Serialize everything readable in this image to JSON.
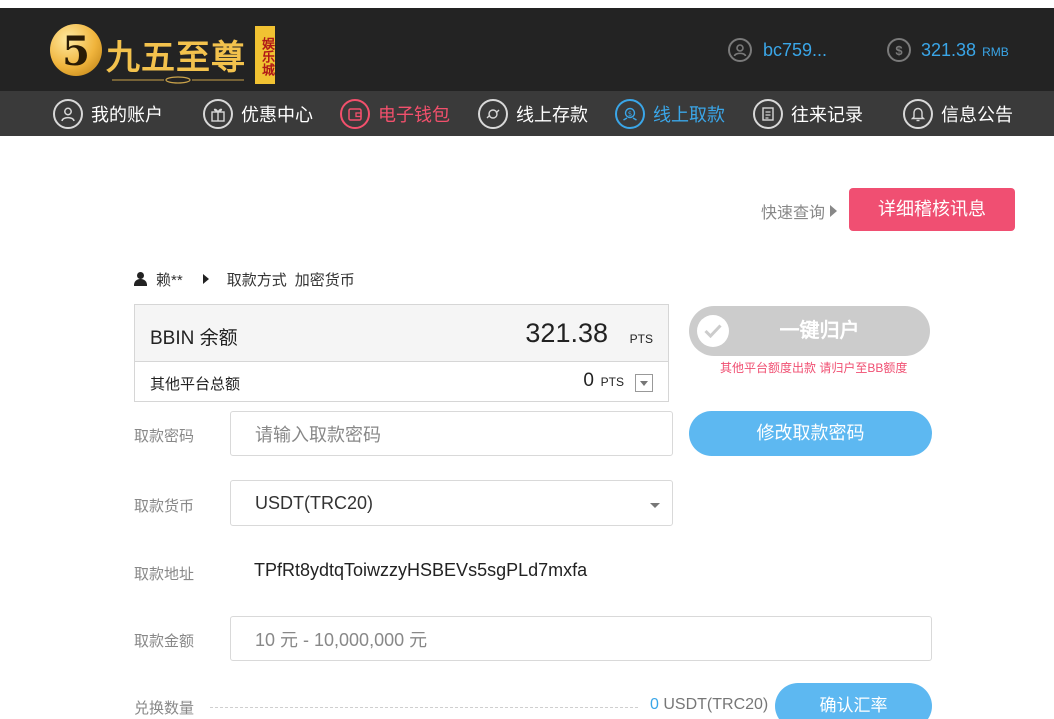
{
  "header": {
    "logo": {
      "glyph": "5",
      "brand": "九五至尊",
      "seal": "娱乐城"
    },
    "user": {
      "icon": "user-circle-icon",
      "username": "bc759..."
    },
    "balance": {
      "icon": "dollar-circle-icon",
      "value": "321.38",
      "currency": "RMB"
    }
  },
  "nav": {
    "items": [
      {
        "label": "我的账户",
        "icon": "user-circle-icon"
      },
      {
        "label": "优惠中心",
        "icon": "gift-icon"
      },
      {
        "label": "电子钱包",
        "icon": "wallet-icon",
        "state": "highlight-red"
      },
      {
        "label": "线上存款",
        "icon": "deposit-icon"
      },
      {
        "label": "线上取款",
        "icon": "withdraw-icon",
        "state": "active"
      },
      {
        "label": "往来记录",
        "icon": "record-icon"
      },
      {
        "label": "信息公告",
        "icon": "bell-icon"
      }
    ]
  },
  "toolbar": {
    "quick_query": "快速查询",
    "detail_button": "详细稽核讯息"
  },
  "crumb": {
    "user": "赖**",
    "method_label": "取款方式",
    "method_value": "加密货币"
  },
  "balances": {
    "main_label": "BBIN 余额",
    "main_value": "321.38",
    "main_unit": "PTS",
    "other_label": "其他平台总额",
    "other_value": "0",
    "other_unit": "PTS"
  },
  "one_key": {
    "label": "一键归户",
    "note": "其他平台额度出款 请归户至BB额度"
  },
  "form": {
    "password_label": "取款密码",
    "password_placeholder": "请输入取款密码",
    "change_password_button": "修改取款密码",
    "currency_label": "取款货币",
    "currency_value": "USDT(TRC20)",
    "address_label": "取款地址",
    "address_value": "TPfRt8ydtqToiwzzyHSBEVs5sgPLd7mxfa",
    "amount_label": "取款金额",
    "amount_placeholder": "10 元 - 10,000,000 元",
    "convert_label": "兑换数量",
    "convert_value": "0",
    "convert_unit": "USDT(TRC20)",
    "confirm_rate_button": "确认汇率"
  },
  "colors": {
    "accent_blue": "#3aa6e8",
    "accent_red": "#f04f72",
    "header_bg": "#232323",
    "nav_bg": "#3a3a3a"
  }
}
